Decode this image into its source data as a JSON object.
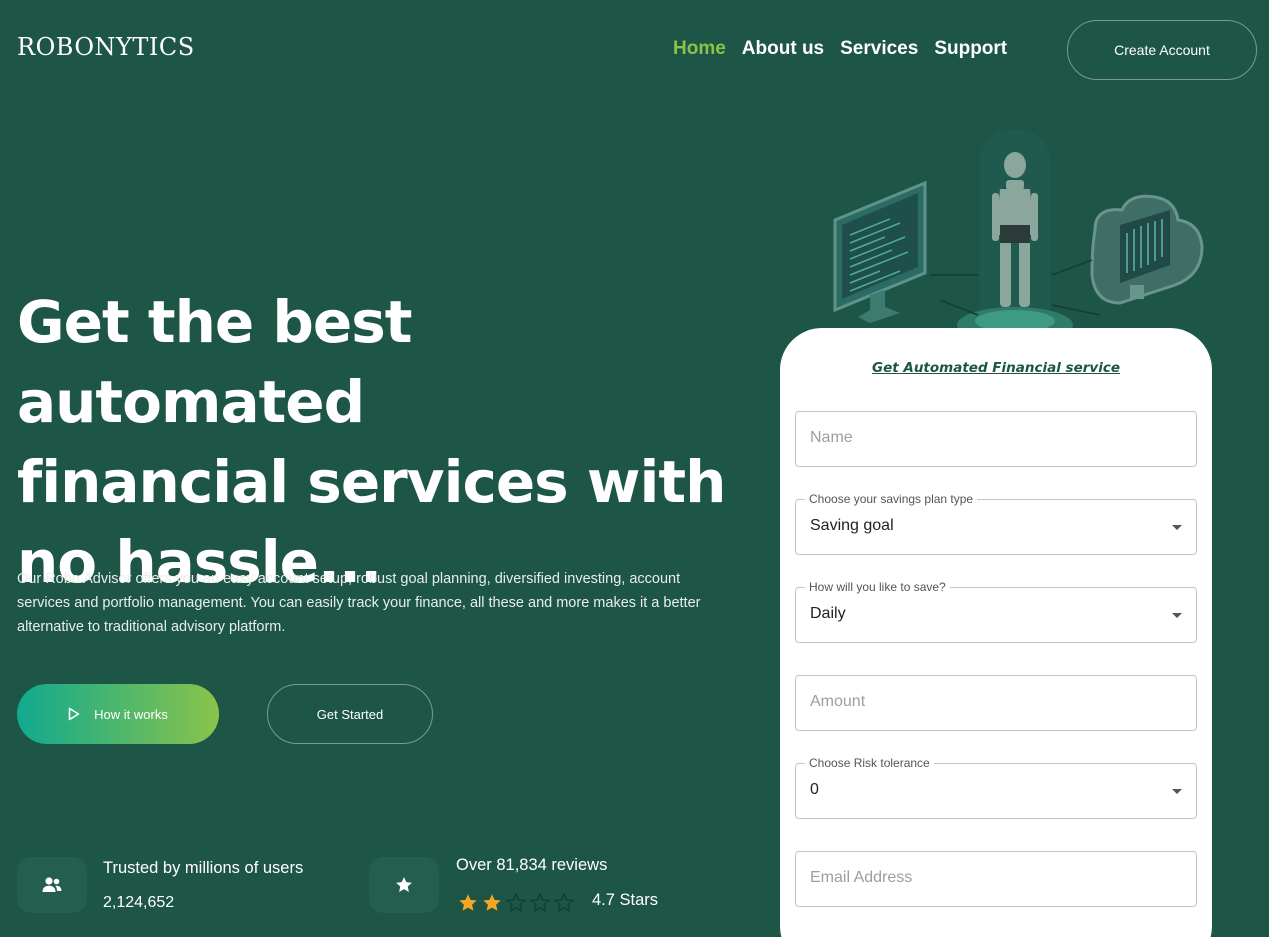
{
  "brand": {
    "logo_text": "ROBONYTICS"
  },
  "nav": {
    "items": [
      {
        "label": "Home",
        "active": true
      },
      {
        "label": "About us",
        "active": false
      },
      {
        "label": "Services",
        "active": false
      },
      {
        "label": "Support",
        "active": false
      }
    ],
    "cta_label": "Create Account"
  },
  "hero": {
    "title_lines": [
      "Get the best automated",
      "financial services with",
      "no hassle..."
    ],
    "description": "Our Robo Advisor offers you an easy account setup, robust goal planning, diversified investing, account services and portfolio management. You can easily track your finance, all these and more makes it a better alternative to traditional advisory platform.",
    "how_it_works_label": "How it works",
    "get_started_label": "Get Started"
  },
  "stats": {
    "users": {
      "title": "Trusted by millions of users",
      "value": "2,124,652",
      "icon": "users-icon"
    },
    "reviews": {
      "title": "Over 81,834 reviews",
      "rating_label": "4.7 Stars",
      "filled_stars": 2,
      "total_stars": 5,
      "icon": "star-icon"
    }
  },
  "form": {
    "heading": "Get Automated Financial service",
    "name_placeholder": "Name",
    "plan_type": {
      "label": "Choose your savings plan type",
      "value": "Saving goal"
    },
    "frequency": {
      "label": "How will you like to save?",
      "value": "Daily"
    },
    "amount_placeholder": "Amount",
    "risk": {
      "label": "Choose Risk tolerance",
      "value": "0"
    },
    "email_placeholder": "Email Address"
  },
  "colors": {
    "background": "#1d5546",
    "accent_green": "#8bc34a",
    "gradient_start": "#10aa8f",
    "star_filled": "#f5a623"
  }
}
